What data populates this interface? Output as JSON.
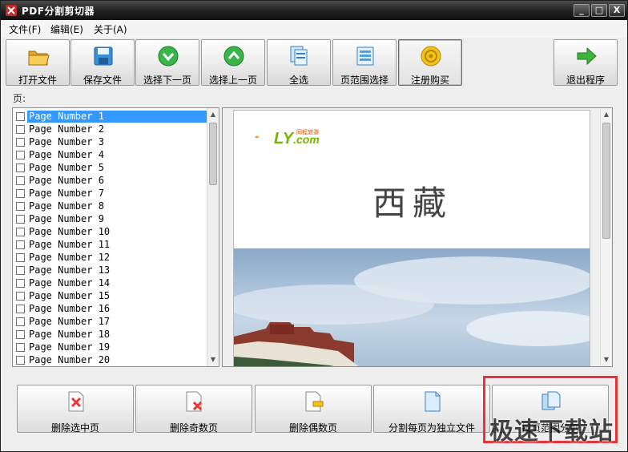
{
  "window": {
    "title": "PDF分割剪切器",
    "controls": {
      "minimize": "_",
      "maximize": "□",
      "close": "X"
    }
  },
  "menu": {
    "items": [
      "文件(F)",
      "编辑(E)",
      "关于(A)"
    ]
  },
  "toolbar": {
    "buttons": [
      {
        "label": "打开文件",
        "icon": "folder-open-icon"
      },
      {
        "label": "保存文件",
        "icon": "floppy-save-icon"
      },
      {
        "label": "选择下一页",
        "icon": "green-down-arrow-icon"
      },
      {
        "label": "选择上一页",
        "icon": "green-up-arrow-icon"
      },
      {
        "label": "全选",
        "icon": "select-all-pages-icon"
      },
      {
        "label": "页范围选择",
        "icon": "page-range-icon"
      },
      {
        "label": "注册购买",
        "icon": "gold-coin-icon"
      },
      {
        "label": "退出程序",
        "icon": "exit-arrow-icon"
      }
    ]
  },
  "pages_label": "页:",
  "page_list": {
    "selected_index": 0,
    "items": [
      "Page Number 1",
      "Page Number 2",
      "Page Number 3",
      "Page Number 4",
      "Page Number 5",
      "Page Number 6",
      "Page Number 7",
      "Page Number 8",
      "Page Number 9",
      "Page Number 10",
      "Page Number 11",
      "Page Number 12",
      "Page Number 13",
      "Page Number 14",
      "Page Number 15",
      "Page Number 16",
      "Page Number 17",
      "Page Number 18",
      "Page Number 19",
      "Page Number 20"
    ]
  },
  "preview": {
    "logo_main": "LY",
    "logo_domain": ".com",
    "logo_tagline": "同程旅游",
    "document_title": "西藏"
  },
  "actions": {
    "buttons": [
      {
        "label": "删除选中页",
        "icon": "delete-page-icon"
      },
      {
        "label": "删除奇数页",
        "icon": "delete-odd-pages-icon"
      },
      {
        "label": "删除偶数页",
        "icon": "delete-even-pages-icon"
      },
      {
        "label": "分割每页为独立文件",
        "icon": "split-pages-icon"
      },
      {
        "label": "按页范围分割",
        "icon": "split-range-icon"
      }
    ]
  },
  "watermark": "极速下载站",
  "colors": {
    "selection": "#3399ff",
    "highlight": "#e8333a",
    "logo_green": "#7cb300"
  }
}
